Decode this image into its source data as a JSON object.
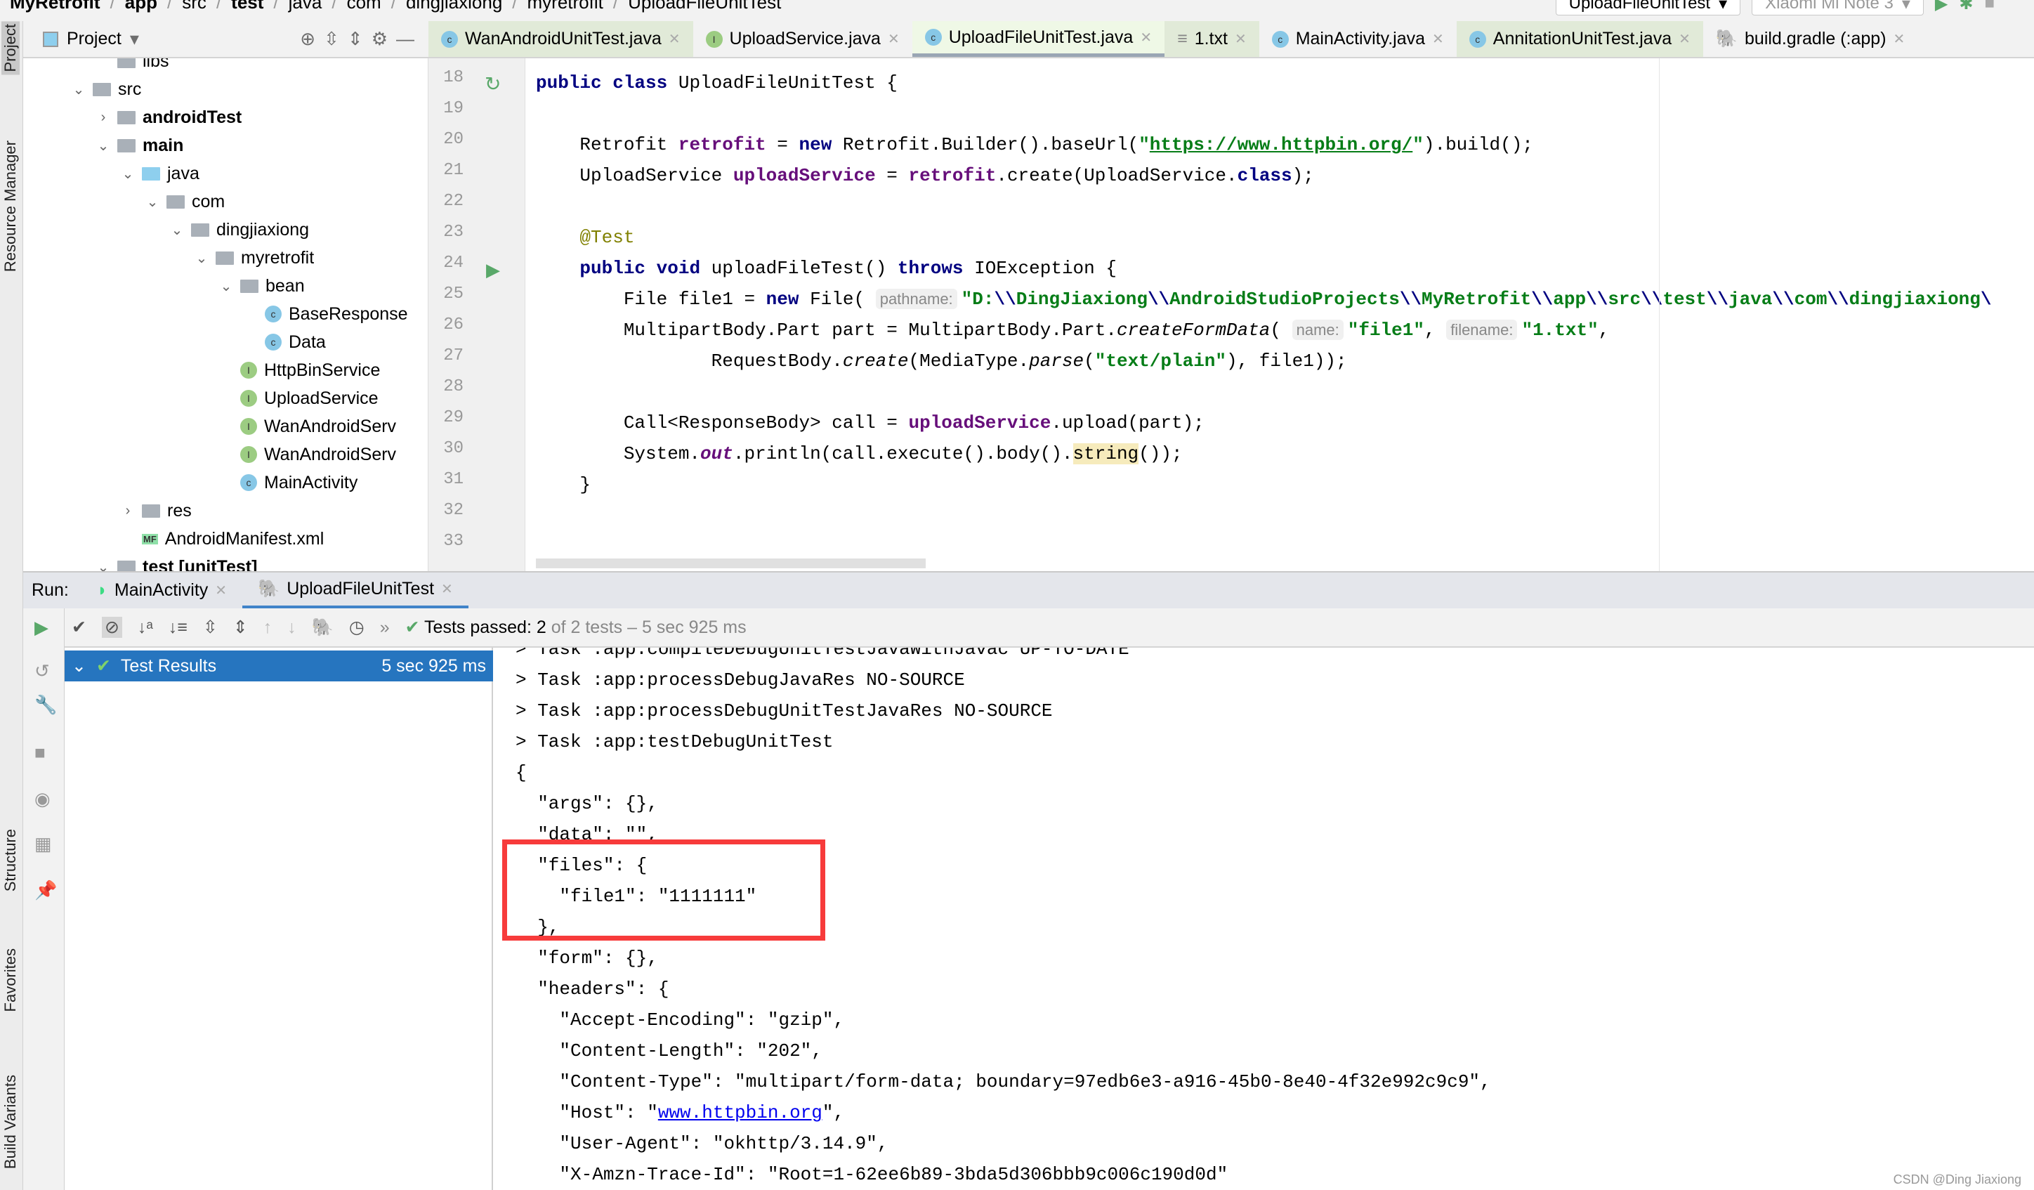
{
  "breadcrumb": [
    "MyRetrofit",
    "app",
    "src",
    "test",
    "java",
    "com",
    "dingjiaxiong",
    "myretrofit",
    "UploadFileUnitTest"
  ],
  "toolbar": {
    "run_config": "UploadFileUnitTest",
    "device": "Xiaomi Mi Note 3"
  },
  "left_strip": [
    "Project",
    "Resource Manager",
    "Structure",
    "Favorites",
    "Build Variants"
  ],
  "project_panel": {
    "title": "Project"
  },
  "tree": [
    {
      "label": "libs",
      "depth": 3,
      "icon": "folder",
      "chev": ""
    },
    {
      "label": "src",
      "depth": 2,
      "icon": "folder",
      "chev": "down"
    },
    {
      "label": "androidTest",
      "depth": 3,
      "icon": "folder",
      "chev": "right",
      "bold": true
    },
    {
      "label": "main",
      "depth": 3,
      "icon": "folder",
      "chev": "down",
      "bold": true
    },
    {
      "label": "java",
      "depth": 4,
      "icon": "folder-blue",
      "chev": "down"
    },
    {
      "label": "com",
      "depth": 5,
      "icon": "package",
      "chev": "down"
    },
    {
      "label": "dingjiaxiong",
      "depth": 6,
      "icon": "package",
      "chev": "down"
    },
    {
      "label": "myretrofit",
      "depth": 7,
      "icon": "package",
      "chev": "down"
    },
    {
      "label": "bean",
      "depth": 8,
      "icon": "package",
      "chev": "down"
    },
    {
      "label": "BaseResponse",
      "depth": 9,
      "icon": "class",
      "chev": ""
    },
    {
      "label": "Data",
      "depth": 9,
      "icon": "class",
      "chev": ""
    },
    {
      "label": "HttpBinService",
      "depth": 8,
      "icon": "interface",
      "chev": ""
    },
    {
      "label": "UploadService",
      "depth": 8,
      "icon": "interface",
      "chev": ""
    },
    {
      "label": "WanAndroidServ",
      "depth": 8,
      "icon": "interface",
      "chev": ""
    },
    {
      "label": "WanAndroidServ",
      "depth": 8,
      "icon": "interface",
      "chev": ""
    },
    {
      "label": "MainActivity",
      "depth": 8,
      "icon": "class",
      "chev": ""
    },
    {
      "label": "res",
      "depth": 4,
      "icon": "folder",
      "chev": "right"
    },
    {
      "label": "AndroidManifest.xml",
      "depth": 4,
      "icon": "manifest",
      "chev": ""
    },
    {
      "label": "test [unitTest]",
      "depth": 3,
      "icon": "folder",
      "chev": "down",
      "bold": true
    }
  ],
  "tabs": [
    {
      "label": "WanAndroidUnitTest.java",
      "icon": "class",
      "style": "g"
    },
    {
      "label": "UploadService.java",
      "icon": "interface",
      "style": ""
    },
    {
      "label": "UploadFileUnitTest.java",
      "icon": "class",
      "style": "act"
    },
    {
      "label": "1.txt",
      "icon": "text",
      "style": "g"
    },
    {
      "label": "MainActivity.java",
      "icon": "class",
      "style": ""
    },
    {
      "label": "AnnitationUnitTest.java",
      "icon": "class",
      "style": "g"
    },
    {
      "label": "build.gradle (:app)",
      "icon": "gradle",
      "style": ""
    }
  ],
  "line_numbers": [
    "18",
    "19",
    "20",
    "21",
    "22",
    "23",
    "24",
    "25",
    "26",
    "27",
    "28",
    "29",
    "30",
    "31",
    "32",
    "33"
  ],
  "code": [
    [
      [
        "public class ",
        "kw"
      ],
      [
        "UploadFileUnitTest {",
        ""
      ]
    ],
    [],
    [
      [
        "    Retrofit ",
        ""
      ],
      [
        "retrofit",
        "fld"
      ],
      [
        " = ",
        ""
      ],
      [
        "new ",
        "kw"
      ],
      [
        "Retrofit.Builder().baseUrl(",
        ""
      ],
      [
        "\"",
        "str"
      ],
      [
        "https://www.httpbin.org/",
        "url"
      ],
      [
        "\"",
        "str"
      ],
      [
        ").build();",
        ""
      ]
    ],
    [
      [
        "    UploadService ",
        ""
      ],
      [
        "uploadService",
        "fld"
      ],
      [
        " = ",
        ""
      ],
      [
        "retrofit",
        "fld"
      ],
      [
        ".create(UploadService.",
        ""
      ],
      [
        "class",
        "kw"
      ],
      [
        ");",
        ""
      ]
    ],
    [],
    [
      [
        "    @Test",
        "ann"
      ]
    ],
    [
      [
        "    ",
        ""
      ],
      [
        "public void ",
        "kw"
      ],
      [
        "uploadFileTest() ",
        ""
      ],
      [
        "throws ",
        "kw"
      ],
      [
        "IOException {",
        ""
      ]
    ],
    [
      [
        "        File file1 = ",
        ""
      ],
      [
        "new ",
        "kw"
      ],
      [
        "File( ",
        ""
      ],
      [
        "pathname:",
        "hint"
      ],
      [
        "\"D:",
        "str"
      ],
      [
        "\\\\",
        "esc"
      ],
      [
        "DingJiaxiong",
        "str"
      ],
      [
        "\\\\",
        "esc"
      ],
      [
        "AndroidStudioProjects",
        "str"
      ],
      [
        "\\\\",
        "esc"
      ],
      [
        "MyRetrofit",
        "str"
      ],
      [
        "\\\\",
        "esc"
      ],
      [
        "app",
        "str"
      ],
      [
        "\\\\",
        "esc"
      ],
      [
        "src",
        "str"
      ],
      [
        "\\\\",
        "esc"
      ],
      [
        "test",
        "str"
      ],
      [
        "\\\\",
        "esc"
      ],
      [
        "java",
        "str"
      ],
      [
        "\\\\",
        "esc"
      ],
      [
        "com",
        "str"
      ],
      [
        "\\\\",
        "esc"
      ],
      [
        "dingjiaxiong",
        "str"
      ],
      [
        "\\",
        "esc"
      ]
    ],
    [
      [
        "        MultipartBody.Part part = MultipartBody.Part.",
        ""
      ],
      [
        "createFormData",
        "it"
      ],
      [
        "( ",
        ""
      ],
      [
        "name:",
        "hint"
      ],
      [
        "\"file1\"",
        "str"
      ],
      [
        ", ",
        ""
      ],
      [
        "filename:",
        "hint"
      ],
      [
        "\"1.txt\"",
        "str"
      ],
      [
        ",",
        ""
      ]
    ],
    [
      [
        "                RequestBody.",
        ""
      ],
      [
        "create",
        "it"
      ],
      [
        "(MediaType.",
        ""
      ],
      [
        "parse",
        "it"
      ],
      [
        "(",
        ""
      ],
      [
        "\"text/plain\"",
        "str"
      ],
      [
        "), file1));",
        ""
      ]
    ],
    [],
    [
      [
        "        Call<ResponseBody> call = ",
        ""
      ],
      [
        "uploadService",
        "fld"
      ],
      [
        ".upload(part);",
        ""
      ]
    ],
    [
      [
        "        System.",
        ""
      ],
      [
        "out",
        "fi"
      ],
      [
        ".println(call.execute().body().",
        ""
      ],
      [
        "string",
        "hl"
      ],
      [
        "());",
        ""
      ]
    ],
    [
      [
        "    }",
        ""
      ]
    ],
    [],
    []
  ],
  "run": {
    "label": "Run:",
    "tabs": [
      "MainActivity",
      "UploadFileUnitTest"
    ],
    "status_main": "Tests passed: 2",
    "status_rest": " of 2 tests – 5 sec 925 ms",
    "test_results": "Test Results",
    "test_time": "5 sec 925 ms"
  },
  "console": [
    "> Task :app:compileDebugUnitTestJavaWithJavac UP-TO-DATE",
    "> Task :app:processDebugJavaRes NO-SOURCE",
    "> Task :app:processDebugUnitTestJavaRes NO-SOURCE",
    "> Task :app:testDebugUnitTest",
    "{",
    "  \"args\": {},",
    "  \"data\": \"\",",
    "  \"files\": {",
    "    \"file1\": \"1111111\"",
    "  },",
    "  \"form\": {},",
    "  \"headers\": {",
    "    \"Accept-Encoding\": \"gzip\",",
    "    \"Content-Length\": \"202\",",
    "    \"Content-Type\": \"multipart/form-data; boundary=97edb6e3-a916-45b0-8e40-4f32e992c9c9\",",
    "    \"Host\": \"",
    "    \"User-Agent\": \"okhttp/3.14.9\",",
    "    \"X-Amzn-Trace-Id\": \"Root=1-62ee6b89-3bda5d306bbb9c006c190d0d\""
  ],
  "console_host_link": "www.httpbin.org",
  "console_host_tail": "\",",
  "watermark": "CSDN @Ding Jiaxiong",
  "colors": {
    "accent": "#2675bf",
    "highlight_box": "#f73b3b",
    "pass": "#59a869"
  }
}
